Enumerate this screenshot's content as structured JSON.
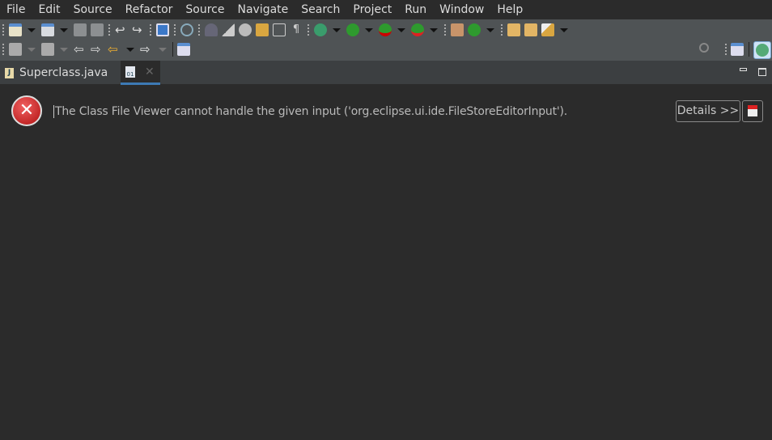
{
  "menu": [
    "File",
    "Edit",
    "Source",
    "Refactor",
    "Source",
    "Navigate",
    "Search",
    "Project",
    "Run",
    "Window",
    "Help"
  ],
  "tabs": [
    {
      "label": "Superclass.java"
    },
    {
      "label": ""
    }
  ],
  "error": {
    "message": "The Class File Viewer cannot handle the given input ('org.eclipse.ui.ide.FileStoreEditorInput').",
    "details_label": "Details >>"
  },
  "colors": {
    "menubar": "#2b2b2b",
    "toolbar": "#4f5355",
    "tabbar": "#3c3f41",
    "editor": "#2b2b2b",
    "active_tab_underline": "#3d7ab5"
  }
}
